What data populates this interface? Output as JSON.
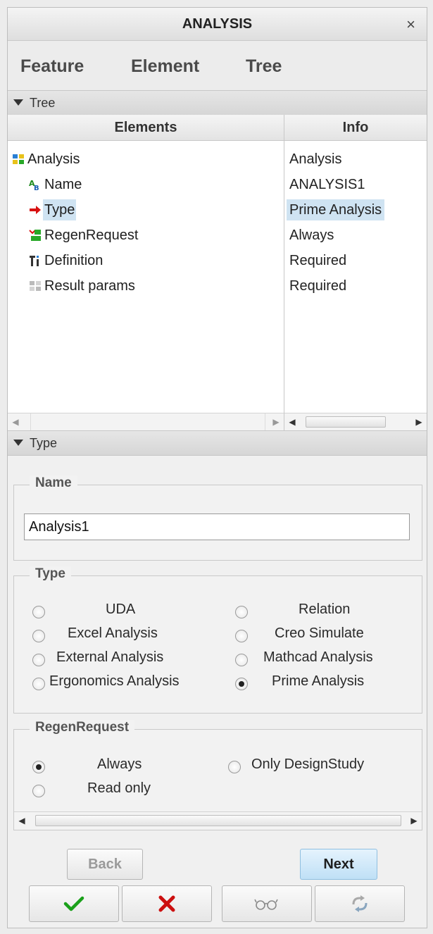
{
  "window": {
    "title": "ANALYSIS",
    "close_glyph": "×"
  },
  "menu": [
    "Feature",
    "Element",
    "Tree"
  ],
  "tree_section": {
    "header": "Tree",
    "columns": {
      "elements": "Elements",
      "info": "Info"
    },
    "rows": [
      {
        "label": "Analysis",
        "info": "Analysis",
        "icon": "analysis-feature-icon"
      },
      {
        "label": "Name",
        "info": "ANALYSIS1",
        "icon": "name-text-icon"
      },
      {
        "label": "Type",
        "info": "Prime Analysis",
        "icon": "current-element-arrow-icon",
        "selected": true
      },
      {
        "label": "RegenRequest",
        "info": "Always",
        "icon": "regen-request-icon"
      },
      {
        "label": "Definition",
        "info": "Required",
        "icon": "definition-icon"
      },
      {
        "label": "Result params",
        "info": "Required",
        "icon": "result-params-icon"
      }
    ]
  },
  "type_section": {
    "header": "Type",
    "name_group": {
      "legend": "Name",
      "value": "Analysis1"
    },
    "type_group": {
      "legend": "Type",
      "options": [
        {
          "label": "UDA",
          "selected": false
        },
        {
          "label": "Relation",
          "selected": false
        },
        {
          "label": "Excel Analysis",
          "selected": false
        },
        {
          "label": "Creo Simulate",
          "selected": false
        },
        {
          "label": "External Analysis",
          "selected": false
        },
        {
          "label": "Mathcad Analysis",
          "selected": false
        },
        {
          "label": "Ergonomics Analysis",
          "selected": false
        },
        {
          "label": "Prime Analysis",
          "selected": true
        }
      ]
    },
    "regen_group": {
      "legend": "RegenRequest",
      "options": [
        {
          "label": "Always",
          "selected": true
        },
        {
          "label": "Only DesignStudy",
          "selected": false
        },
        {
          "label": "Read only",
          "selected": false
        }
      ]
    }
  },
  "buttons": {
    "back": "Back",
    "next": "Next",
    "ok_icon": "checkmark-icon",
    "cancel_icon": "x-cancel-icon",
    "preview_icon": "glasses-preview-icon",
    "refresh_icon": "regenerate-arrows-icon"
  },
  "colors": {
    "selection": "#cfe3f2",
    "ok_green": "#1aa01a",
    "cancel_red": "#cc1010"
  }
}
